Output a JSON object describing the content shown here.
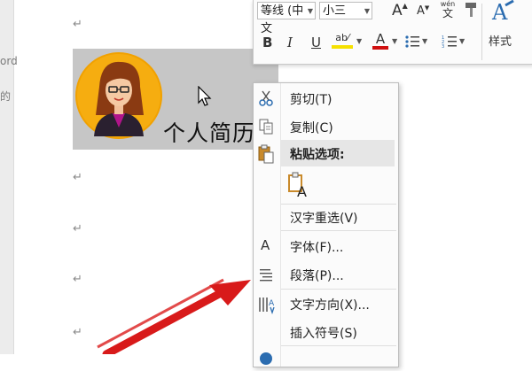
{
  "document": {
    "edge_text_1": "ord",
    "edge_text_2": "的",
    "para_mark": "↵",
    "title": "个人简历"
  },
  "mini_toolbar": {
    "font_name": "等线 (中文",
    "font_size": "小三",
    "grow_font": "A",
    "shrink_font": "A",
    "phonetic_guide": "wén",
    "phonetic_guide_char": "文",
    "bold": "B",
    "italic": "I",
    "underline": "U",
    "highlight": "ab⁄",
    "font_color": "A",
    "styles_label": "样式",
    "accent_highlight": "#f5e100",
    "accent_font_color": "#d01010"
  },
  "context_menu": {
    "items": [
      {
        "label": "剪切(T)",
        "icon": "scissors-icon"
      },
      {
        "label": "复制(C)",
        "icon": "copy-icon"
      },
      {
        "label": "粘贴选项:",
        "icon": "paste-icon"
      },
      {
        "label": "",
        "icon": "paste-keep-text-icon"
      },
      {
        "label": "汉字重选(V)",
        "icon": ""
      },
      {
        "label": "字体(F)...",
        "icon": "font-icon"
      },
      {
        "label": "段落(P)...",
        "icon": "paragraph-icon"
      },
      {
        "label": "文字方向(X)...",
        "icon": "text-direction-icon"
      },
      {
        "label": "插入符号(S)",
        "icon": ""
      }
    ]
  },
  "colors": {
    "selection_bg": "#c6c6c6",
    "arrow": "#d81a1a",
    "avatar_ring": "#f1a100"
  }
}
